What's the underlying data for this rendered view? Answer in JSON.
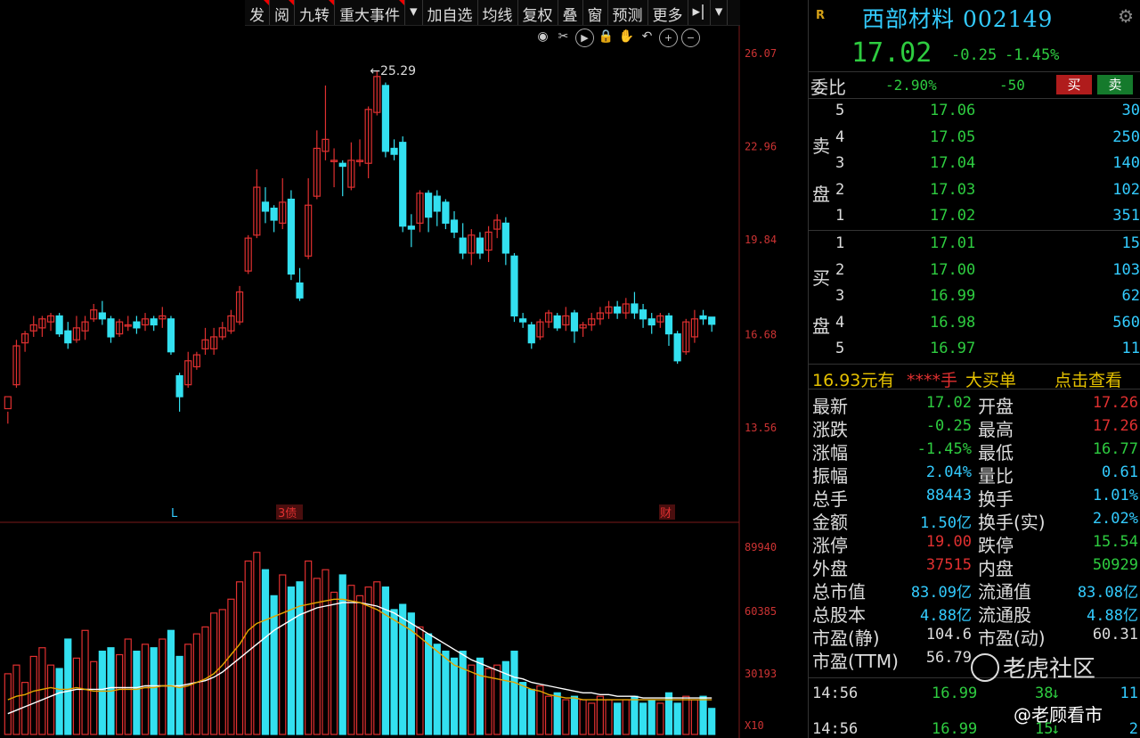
{
  "toolbar": {
    "items": [
      "发",
      "阅",
      "九转",
      "重大事件",
      "▾",
      "加自选",
      "均线",
      "复权",
      "叠",
      "窗",
      "预测",
      "更多",
      "▸|",
      "▾"
    ],
    "flagged": [
      true,
      true,
      true,
      true,
      false,
      false,
      false,
      false,
      false,
      false,
      false,
      false,
      false,
      false
    ]
  },
  "tool_icons": [
    "eye-icon",
    "scissors-icon",
    "play-icon",
    "lock-icon",
    "hand-icon",
    "undo-icon",
    "zoom-in-icon",
    "zoom-out-icon"
  ],
  "price_axis": [
    "26.07",
    "22.96",
    "19.84",
    "16.68",
    "13.56"
  ],
  "volume_axis": [
    "89940",
    "60385",
    "30193",
    "X10"
  ],
  "markers": {
    "left": "L",
    "mid": "3债",
    "right": "财"
  },
  "high_annotation": "←25.29",
  "chart_data": {
    "type": "candlestick",
    "ylim": [
      12.5,
      26.5
    ],
    "candles": [
      [
        14.2,
        14.6,
        14.1,
        13.7
      ],
      [
        15.0,
        16.3,
        16.5,
        14.9
      ],
      [
        16.4,
        16.7,
        16.8,
        16.1
      ],
      [
        16.8,
        17.0,
        17.3,
        16.6
      ],
      [
        16.9,
        17.2,
        17.3,
        16.6
      ],
      [
        17.1,
        17.3,
        17.4,
        16.8
      ],
      [
        17.3,
        16.7,
        17.4,
        16.6
      ],
      [
        16.8,
        16.4,
        17.1,
        16.2
      ],
      [
        16.5,
        16.9,
        17.3,
        16.4
      ],
      [
        16.8,
        17.1,
        17.3,
        16.5
      ],
      [
        17.2,
        17.5,
        17.7,
        17.1
      ],
      [
        17.4,
        17.2,
        17.8,
        17.0
      ],
      [
        17.2,
        16.6,
        17.3,
        16.4
      ],
      [
        16.7,
        17.1,
        17.2,
        16.6
      ],
      [
        17.0,
        17.0,
        17.3,
        16.8
      ],
      [
        17.1,
        16.9,
        17.3,
        16.7
      ],
      [
        17.0,
        17.2,
        17.4,
        16.8
      ],
      [
        17.2,
        17.0,
        17.3,
        16.8
      ],
      [
        17.2,
        17.3,
        17.6,
        16.9
      ],
      [
        17.2,
        16.1,
        17.3,
        16.0
      ],
      [
        15.3,
        14.6,
        15.4,
        14.1
      ],
      [
        15.0,
        15.8,
        16.1,
        14.9
      ],
      [
        15.6,
        16.0,
        16.1,
        15.5
      ],
      [
        16.2,
        16.5,
        16.9,
        16.0
      ],
      [
        16.2,
        16.6,
        16.9,
        16.0
      ],
      [
        16.6,
        16.9,
        17.1,
        16.5
      ],
      [
        16.8,
        17.3,
        17.5,
        16.7
      ],
      [
        17.1,
        18.1,
        18.3,
        17.0
      ],
      [
        18.8,
        19.9,
        20.0,
        18.7
      ],
      [
        20.0,
        21.6,
        22.2,
        19.9
      ],
      [
        21.1,
        20.8,
        21.6,
        20.4
      ],
      [
        20.9,
        20.5,
        21.0,
        20.1
      ],
      [
        20.4,
        21.1,
        21.9,
        20.2
      ],
      [
        21.2,
        18.7,
        21.5,
        18.5
      ],
      [
        18.4,
        17.9,
        18.9,
        17.8
      ],
      [
        19.3,
        21.0,
        21.9,
        19.2
      ],
      [
        21.3,
        22.9,
        23.5,
        21.2
      ],
      [
        22.8,
        23.2,
        25.0,
        22.5
      ],
      [
        22.5,
        22.5,
        22.9,
        21.6
      ],
      [
        22.4,
        22.3,
        22.5,
        21.3
      ],
      [
        21.6,
        22.5,
        23.1,
        21.5
      ],
      [
        22.5,
        22.5,
        23.2,
        22.3
      ],
      [
        22.4,
        24.2,
        24.3,
        21.9
      ],
      [
        24.1,
        25.3,
        25.5,
        24.0
      ],
      [
        25.0,
        22.8,
        25.1,
        22.6
      ],
      [
        22.9,
        22.7,
        23.2,
        22.5
      ],
      [
        23.1,
        20.3,
        23.3,
        20.1
      ],
      [
        20.3,
        20.2,
        20.7,
        19.6
      ],
      [
        20.4,
        21.4,
        21.5,
        20.1
      ],
      [
        21.4,
        20.6,
        21.5,
        20.1
      ],
      [
        21.3,
        20.8,
        21.5,
        20.3
      ],
      [
        21.1,
        20.4,
        21.2,
        20.2
      ],
      [
        20.5,
        20.1,
        20.8,
        19.9
      ],
      [
        19.9,
        19.4,
        20.4,
        19.2
      ],
      [
        19.4,
        20.0,
        20.2,
        19.0
      ],
      [
        19.9,
        19.4,
        20.1,
        19.2
      ],
      [
        19.5,
        20.1,
        20.3,
        19.1
      ],
      [
        20.2,
        20.5,
        20.7,
        19.9
      ],
      [
        20.4,
        19.4,
        20.6,
        19.0
      ],
      [
        19.3,
        17.3,
        19.4,
        17.1
      ],
      [
        17.2,
        17.1,
        17.4,
        16.9
      ],
      [
        17.0,
        16.4,
        17.1,
        16.2
      ],
      [
        16.6,
        17.1,
        17.2,
        16.5
      ],
      [
        17.1,
        17.4,
        17.5,
        16.9
      ],
      [
        17.3,
        16.9,
        17.4,
        16.8
      ],
      [
        17.0,
        17.3,
        17.6,
        16.8
      ],
      [
        17.4,
        16.8,
        17.5,
        16.4
      ],
      [
        16.9,
        17.0,
        17.1,
        16.6
      ],
      [
        17.0,
        17.2,
        17.4,
        16.8
      ],
      [
        17.2,
        17.4,
        17.6,
        17.0
      ],
      [
        17.4,
        17.6,
        17.8,
        17.2
      ],
      [
        17.6,
        17.4,
        17.8,
        17.2
      ],
      [
        17.4,
        17.7,
        17.9,
        17.2
      ],
      [
        17.7,
        17.4,
        18.1,
        17.2
      ],
      [
        17.5,
        17.2,
        17.7,
        16.9
      ],
      [
        17.2,
        17.0,
        17.4,
        16.7
      ],
      [
        17.1,
        17.3,
        17.4,
        16.9
      ],
      [
        17.3,
        16.7,
        17.4,
        16.3
      ],
      [
        16.7,
        15.8,
        16.8,
        15.7
      ],
      [
        16.1,
        17.1,
        17.2,
        16.0
      ],
      [
        16.6,
        17.2,
        17.5,
        16.4
      ],
      [
        17.3,
        17.2,
        17.5,
        17.0
      ],
      [
        17.26,
        17.02,
        17.26,
        16.77
      ]
    ],
    "volumes": [
      35,
      40,
      30,
      45,
      50,
      40,
      38,
      55,
      44,
      60,
      42,
      48,
      50,
      46,
      55,
      48,
      52,
      50,
      55,
      60,
      45,
      52,
      58,
      62,
      70,
      72,
      78,
      88,
      100,
      105,
      95,
      80,
      92,
      85,
      88,
      100,
      90,
      95,
      82,
      92,
      86,
      80,
      85,
      88,
      85,
      72,
      75,
      70,
      62,
      58,
      52,
      48,
      44,
      48,
      40,
      44,
      38,
      40,
      42,
      48,
      30,
      26,
      28,
      22,
      24,
      20,
      22,
      20,
      18,
      22,
      20,
      18,
      20,
      22,
      18,
      20,
      18,
      24,
      18,
      22,
      20,
      22,
      15
    ],
    "ma_short": [
      20,
      22,
      23,
      25,
      26,
      27,
      26,
      26,
      27,
      26,
      25,
      25,
      25,
      26,
      26,
      26,
      27,
      27,
      28,
      28,
      27,
      28,
      30,
      32,
      35,
      40,
      46,
      52,
      60,
      64,
      66,
      68,
      70,
      72,
      74,
      75,
      76,
      77,
      78,
      78,
      77,
      76,
      74,
      72,
      69,
      66,
      63,
      60,
      56,
      52,
      48,
      44,
      40,
      38,
      36,
      34,
      33,
      32,
      31,
      30,
      28,
      26,
      25,
      23,
      22,
      21,
      21,
      20,
      20,
      20,
      20,
      20,
      20,
      20,
      20,
      20,
      20,
      20,
      20,
      20,
      20,
      20,
      20
    ],
    "ma_long": [
      12,
      14,
      16,
      18,
      20,
      22,
      24,
      25,
      26,
      26,
      26,
      26,
      27,
      27,
      27,
      27,
      28,
      28,
      28,
      28,
      28,
      29,
      30,
      31,
      33,
      36,
      40,
      44,
      48,
      52,
      56,
      60,
      63,
      66,
      69,
      71,
      73,
      74,
      75,
      76,
      76,
      76,
      75,
      74,
      72,
      70,
      67,
      64,
      61,
      58,
      55,
      52,
      49,
      46,
      43,
      41,
      39,
      37,
      35,
      33,
      32,
      30,
      29,
      28,
      27,
      26,
      25,
      24,
      24,
      23,
      23,
      22,
      22,
      22,
      21,
      21,
      21,
      21,
      21,
      21,
      21,
      21,
      21
    ]
  },
  "panel": {
    "badge": "R",
    "name": "西部材料",
    "code": "002149",
    "price": "17.02",
    "change": "-0.25",
    "change_pct": "-1.45%",
    "wb": {
      "label": "委比",
      "pct": "-2.90%",
      "diff": "-50",
      "buy": "买",
      "sell": "卖"
    },
    "ask_label": [
      "卖",
      "盘"
    ],
    "bid_label": [
      "买",
      "盘"
    ],
    "asks": [
      {
        "lvl": "5",
        "price": "17.06",
        "vol": "30"
      },
      {
        "lvl": "4",
        "price": "17.05",
        "vol": "250"
      },
      {
        "lvl": "3",
        "price": "17.04",
        "vol": "140"
      },
      {
        "lvl": "2",
        "price": "17.03",
        "vol": "102"
      },
      {
        "lvl": "1",
        "price": "17.02",
        "vol": "351"
      }
    ],
    "bids": [
      {
        "lvl": "1",
        "price": "17.01",
        "vol": "15"
      },
      {
        "lvl": "2",
        "price": "17.00",
        "vol": "103"
      },
      {
        "lvl": "3",
        "price": "16.99",
        "vol": "62"
      },
      {
        "lvl": "4",
        "price": "16.98",
        "vol": "560"
      },
      {
        "lvl": "5",
        "price": "16.97",
        "vol": "11"
      }
    ],
    "bigorder": {
      "price": "16.93元有",
      "stars": "****手",
      "label": "大买单",
      "link": "点击查看"
    },
    "stats": [
      [
        "最新",
        "17.02",
        "g",
        "开盘",
        "17.26",
        "r"
      ],
      [
        "涨跌",
        "-0.25",
        "g",
        "最高",
        "17.26",
        "r"
      ],
      [
        "涨幅",
        "-1.45%",
        "g",
        "最低",
        "16.77",
        "g"
      ],
      [
        "振幅",
        "2.04%",
        "c",
        "量比",
        "0.61",
        "c"
      ],
      [
        "总手",
        "88443",
        "c",
        "换手",
        "1.01%",
        "c"
      ],
      [
        "金额",
        "1.50亿",
        "c",
        "换手(实)",
        "2.02%",
        "c"
      ],
      [
        "涨停",
        "19.00",
        "r",
        "跌停",
        "15.54",
        "g"
      ],
      [
        "外盘",
        "37515",
        "r",
        "内盘",
        "50929",
        "g"
      ],
      [
        "总市值",
        "83.09亿",
        "c",
        "流通值",
        "83.08亿",
        "c"
      ],
      [
        "总股本",
        "4.88亿",
        "c",
        "流通股",
        "4.88亿",
        "c"
      ],
      [
        "市盈(静)",
        "104.6",
        "w",
        "市盈(动)",
        "60.31",
        "w"
      ],
      [
        "市盈(TTM)",
        "56.79",
        "w",
        "",
        "",
        " "
      ]
    ],
    "ticks": [
      {
        "time": "14:56",
        "price": "16.99",
        "vol": "38",
        "arrow": "↓",
        "n": "11"
      },
      {
        "time": "14:56",
        "price": "16.99",
        "vol": "15",
        "arrow": "↓",
        "n": "2"
      }
    ]
  },
  "watermark": {
    "text": "老虎社区",
    "author": "@老顾看市"
  }
}
